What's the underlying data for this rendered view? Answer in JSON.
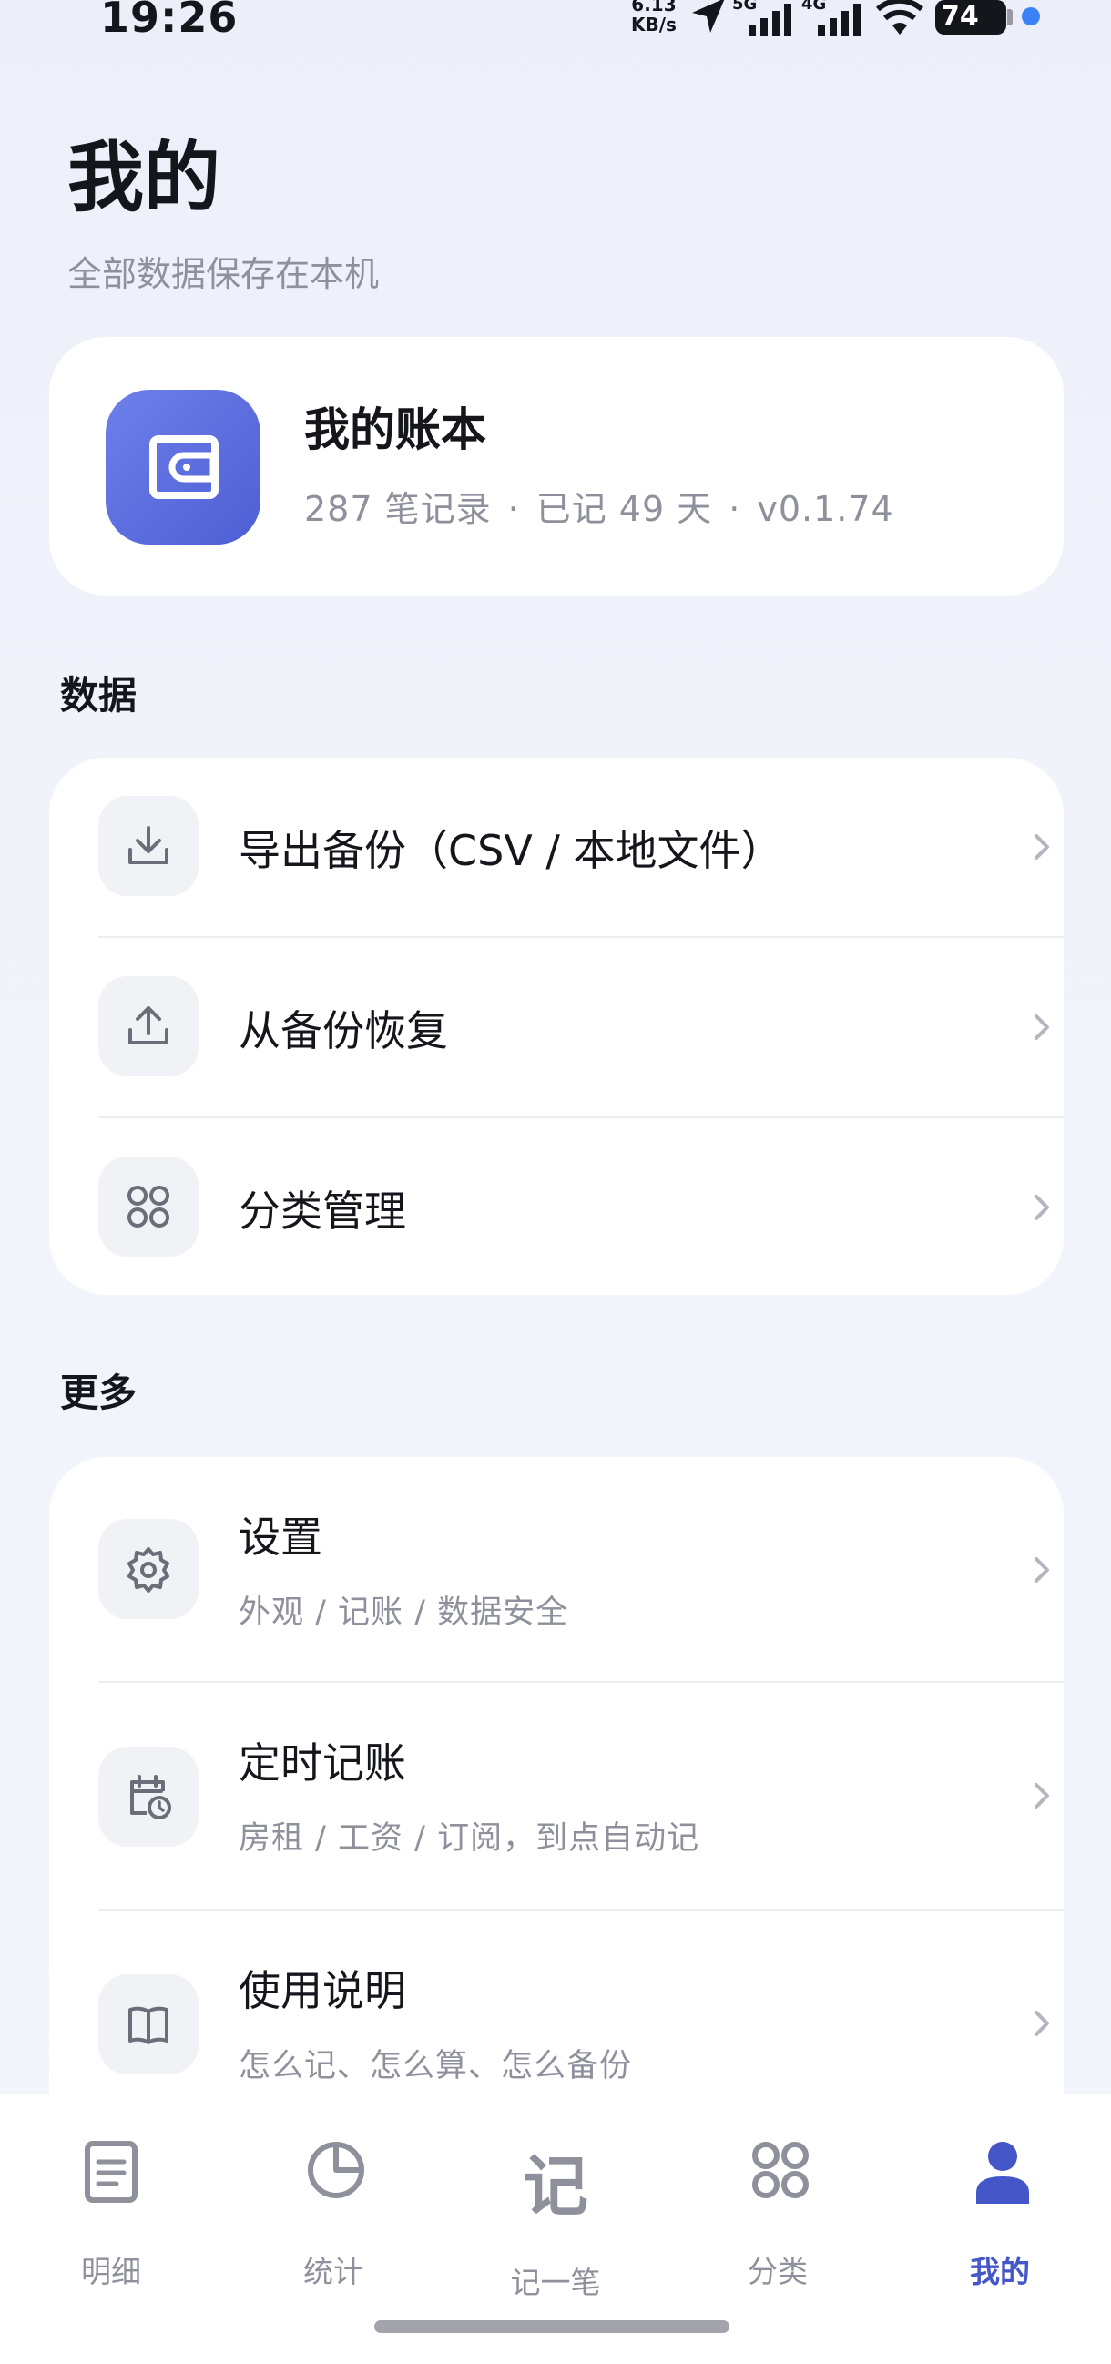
{
  "status_bar": {
    "time": "19:26",
    "net_speed_value": "6.13",
    "net_speed_unit": "KB/s",
    "sig1_label": "5G",
    "sig2_label": "4G",
    "battery": "74"
  },
  "header": {
    "title": "我的",
    "subtitle": "全部数据保存在本机"
  },
  "book": {
    "title": "我的账本",
    "records": "287 笔记录",
    "days": "已记 49 天",
    "version": "v0.1.74",
    "separator": "·"
  },
  "sections": {
    "data": {
      "label": "数据",
      "items": [
        {
          "title": "导出备份（CSV / 本地文件）",
          "icon": "download-icon"
        },
        {
          "title": "从备份恢复",
          "icon": "upload-icon"
        },
        {
          "title": "分类管理",
          "icon": "grid-icon"
        }
      ]
    },
    "more": {
      "label": "更多",
      "items": [
        {
          "title": "设置",
          "subtitle": "外观 / 记账 / 数据安全",
          "icon": "gear-icon"
        },
        {
          "title": "定时记账",
          "subtitle": "房租 / 工资 / 订阅，到点自动记",
          "icon": "calendar-clock-icon"
        },
        {
          "title": "使用说明",
          "subtitle": "怎么记、怎么算、怎么备份",
          "icon": "book-open-icon"
        }
      ]
    }
  },
  "tabs": [
    {
      "label": "明细",
      "icon": "document-list-icon"
    },
    {
      "label": "统计",
      "icon": "pie-chart-icon"
    },
    {
      "label": "记一笔",
      "icon": "record-char-icon",
      "glyph": "记"
    },
    {
      "label": "分类",
      "icon": "grid-icon"
    },
    {
      "label": "我的",
      "icon": "person-icon",
      "active": true
    }
  ],
  "colors": {
    "accent": "#4456c8",
    "wallet_gradient_start": "#6d80ea",
    "wallet_gradient_end": "#4e5fd4",
    "status_dot": "#3b82f6"
  }
}
